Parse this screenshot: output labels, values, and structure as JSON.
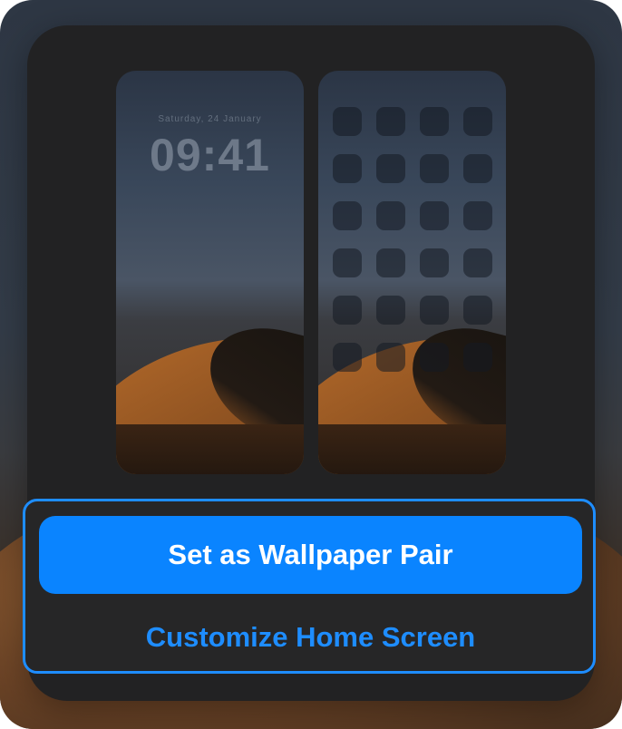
{
  "lock_preview": {
    "date": "Saturday, 24 January",
    "time": "09:41"
  },
  "home_preview": {
    "icon_rows": 6,
    "icons_per_row": 4
  },
  "actions": {
    "primary_label": "Set as Wallpaper Pair",
    "secondary_label": "Customize Home Screen"
  },
  "colors": {
    "accent": "#0a84ff",
    "sheet": "#222223"
  }
}
